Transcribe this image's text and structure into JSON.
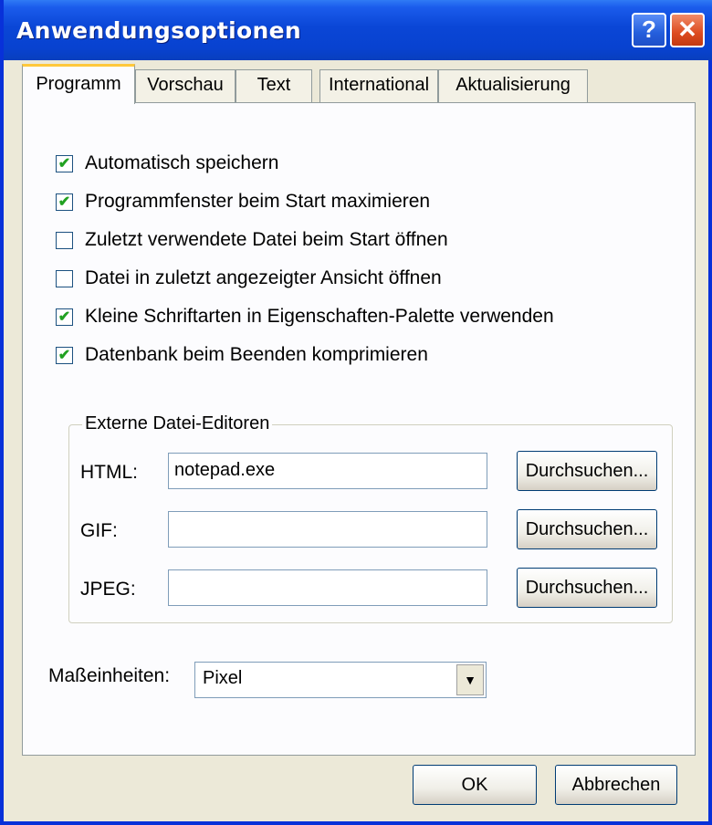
{
  "window": {
    "title": "Anwendungsoptionen",
    "help_glyph": "?",
    "close_glyph": "✕",
    "title_bar_color": "#0a46d6"
  },
  "tabs": [
    {
      "label": "Programm",
      "active": true
    },
    {
      "label": "Vorschau",
      "active": false
    },
    {
      "label": "Text",
      "active": false
    },
    {
      "label": "International",
      "active": false
    },
    {
      "label": "Aktualisierung",
      "active": false
    }
  ],
  "options": [
    {
      "label": "Automatisch speichern",
      "checked": true
    },
    {
      "label": "Programmfenster beim Start maximieren",
      "checked": true
    },
    {
      "label": "Zuletzt verwendete Datei beim Start öffnen",
      "checked": false
    },
    {
      "label": "Datei in zuletzt angezeigter Ansicht öffnen",
      "checked": false
    },
    {
      "label": "Kleine Schriftarten in Eigenschaften-Palette verwenden",
      "checked": true
    },
    {
      "label": "Datenbank beim Beenden komprimieren",
      "checked": true
    }
  ],
  "editors": {
    "legend": "Externe Datei-Editoren",
    "rows": [
      {
        "label": "HTML:",
        "value": "notepad.exe",
        "button": "Durchsuchen..."
      },
      {
        "label": "GIF:",
        "value": "",
        "button": "Durchsuchen..."
      },
      {
        "label": "JPEG:",
        "value": "",
        "button": "Durchsuchen..."
      }
    ]
  },
  "units": {
    "label": "Maßeinheiten:",
    "selected": "Pixel",
    "arrow_glyph": "▼"
  },
  "footer": {
    "ok_label": "OK",
    "cancel_label": "Abbrechen"
  },
  "check_glyph": "✔"
}
